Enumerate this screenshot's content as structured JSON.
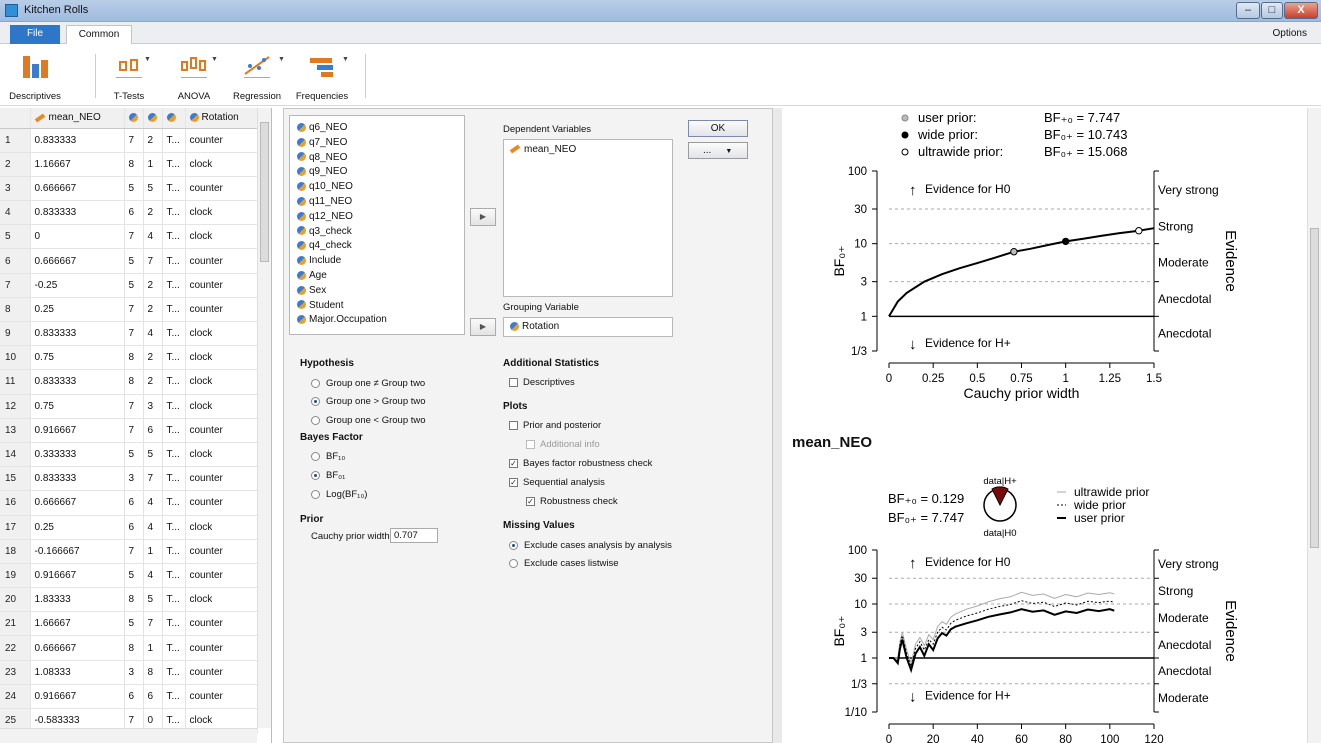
{
  "window": {
    "title": "Kitchen Rolls",
    "minimize": "–",
    "maximize": "□",
    "close": "X"
  },
  "tabs": {
    "file": "File",
    "common": "Common",
    "options": "Options"
  },
  "ribbon": [
    {
      "label": "Descriptives",
      "icon": "descriptives-icon"
    },
    {
      "label": "T-Tests",
      "icon": "ttests-icon"
    },
    {
      "label": "ANOVA",
      "icon": "anova-icon"
    },
    {
      "label": "Regression",
      "icon": "regression-icon"
    },
    {
      "label": "Frequencies",
      "icon": "frequencies-icon"
    }
  ],
  "grid": {
    "columns": [
      "mean_NEO",
      "",
      "",
      "",
      "Rotation"
    ],
    "rows": [
      [
        "1",
        "0.833333",
        "7",
        "2",
        "T...",
        "counter"
      ],
      [
        "2",
        "1.16667",
        "8",
        "1",
        "T...",
        "clock"
      ],
      [
        "3",
        "0.666667",
        "5",
        "5",
        "T...",
        "counter"
      ],
      [
        "4",
        "0.833333",
        "6",
        "2",
        "T...",
        "clock"
      ],
      [
        "5",
        "0",
        "7",
        "4",
        "T...",
        "clock"
      ],
      [
        "6",
        "0.666667",
        "5",
        "7",
        "T...",
        "counter"
      ],
      [
        "7",
        "-0.25",
        "5",
        "2",
        "T...",
        "counter"
      ],
      [
        "8",
        "0.25",
        "7",
        "2",
        "T...",
        "counter"
      ],
      [
        "9",
        "0.833333",
        "7",
        "4",
        "T...",
        "clock"
      ],
      [
        "10",
        "0.75",
        "8",
        "2",
        "T...",
        "clock"
      ],
      [
        "11",
        "0.833333",
        "8",
        "2",
        "T...",
        "clock"
      ],
      [
        "12",
        "0.75",
        "7",
        "3",
        "T...",
        "clock"
      ],
      [
        "13",
        "0.916667",
        "7",
        "6",
        "T...",
        "counter"
      ],
      [
        "14",
        "0.333333",
        "5",
        "5",
        "T...",
        "clock"
      ],
      [
        "15",
        "0.833333",
        "3",
        "7",
        "T...",
        "counter"
      ],
      [
        "16",
        "0.666667",
        "6",
        "4",
        "T...",
        "counter"
      ],
      [
        "17",
        "0.25",
        "6",
        "4",
        "T...",
        "clock"
      ],
      [
        "18",
        "-0.166667",
        "7",
        "1",
        "T...",
        "counter"
      ],
      [
        "19",
        "0.916667",
        "5",
        "4",
        "T...",
        "counter"
      ],
      [
        "20",
        "1.83333",
        "8",
        "5",
        "T...",
        "clock"
      ],
      [
        "21",
        "1.66667",
        "5",
        "7",
        "T...",
        "counter"
      ],
      [
        "22",
        "0.666667",
        "8",
        "1",
        "T...",
        "counter"
      ],
      [
        "23",
        "1.08333",
        "3",
        "8",
        "T...",
        "counter"
      ],
      [
        "24",
        "0.916667",
        "6",
        "6",
        "T...",
        "counter"
      ],
      [
        "25",
        "-0.583333",
        "7",
        "0",
        "T...",
        "clock"
      ]
    ]
  },
  "analysis": {
    "variables": [
      "q6_NEO",
      "q7_NEO",
      "q8_NEO",
      "q9_NEO",
      "q10_NEO",
      "q11_NEO",
      "q12_NEO",
      "q3_check",
      "q4_check",
      "Include",
      "Age",
      "Sex",
      "Student",
      "Major.Occupation"
    ],
    "dependent_label": "Dependent Variables",
    "dependent": "mean_NEO",
    "grouping_label": "Grouping Variable",
    "grouping": "Rotation",
    "ok": "OK",
    "more": "...",
    "hypothesis_title": "Hypothesis",
    "hypotheses": [
      "Group one ≠ Group two",
      "Group one > Group two",
      "Group one < Group two"
    ],
    "bf_title": "Bayes Factor",
    "bf_options": [
      "BF₁₀",
      "BF₀₁",
      "Log(BF₁₀)"
    ],
    "prior_title": "Prior",
    "cauchy_label": "Cauchy prior width",
    "cauchy_value": "0.707",
    "additional_title": "Additional Statistics",
    "descriptives": "Descriptives",
    "plots_title": "Plots",
    "prior_posterior": "Prior and posterior",
    "additional_info": "Additional info",
    "robustness": "Bayes factor robustness check",
    "sequential": "Sequential analysis",
    "robustness_check": "Robustness check",
    "missing_title": "Missing Values",
    "missing_options": [
      "Exclude cases analysis by analysis",
      "Exclude cases listwise"
    ]
  },
  "results": {
    "title": "mean_NEO",
    "chart_data": [
      {
        "type": "line",
        "xlabel": "Cauchy prior width",
        "ylabel": "BF₀₊",
        "right_label": "Evidence",
        "x_ticks": [
          "0",
          "0.25",
          "0.5",
          "0.75",
          "1",
          "1.25",
          "1.5"
        ],
        "y_ticks": [
          "100",
          "30",
          "10",
          "3",
          "1",
          "1/3"
        ],
        "evidence_labels": [
          "Very strong",
          "Strong",
          "Moderate",
          "Anecdotal",
          "Anecdotal"
        ],
        "top_note": "Evidence for H0",
        "bottom_note": "Evidence for H+",
        "legend": [
          {
            "name": "user prior:",
            "bf": "BF₊₀ = 7.747"
          },
          {
            "name": "wide prior:",
            "bf": "BF₀₊ = 10.743"
          },
          {
            "name": "ultrawide prior:",
            "bf": "BF₀₊ = 15.068"
          }
        ],
        "x": [
          0,
          0.05,
          0.1,
          0.2,
          0.3,
          0.4,
          0.5,
          0.6,
          0.707,
          0.8,
          0.9,
          1.0,
          1.1,
          1.2,
          1.3,
          1.414,
          1.5
        ],
        "y": [
          1,
          1.6,
          2.1,
          3.0,
          3.8,
          4.6,
          5.4,
          6.4,
          7.747,
          8.5,
          9.6,
          10.743,
          11.7,
          12.8,
          13.9,
          15.068,
          16.3
        ],
        "points": [
          {
            "x": 0.707,
            "y": 7.747
          },
          {
            "x": 1.0,
            "y": 10.743
          },
          {
            "x": 1.414,
            "y": 15.068
          }
        ]
      },
      {
        "type": "line",
        "xlabel": "",
        "ylabel": "BF₀₊",
        "right_label": "Evidence",
        "x_ticks": [
          "0",
          "20",
          "40",
          "60",
          "80",
          "100",
          "120"
        ],
        "y_ticks": [
          "100",
          "30",
          "10",
          "3",
          "1",
          "1/3",
          "1/10"
        ],
        "evidence_labels": [
          "Very strong",
          "Strong",
          "Moderate",
          "Anecdotal",
          "Anecdotal",
          "Moderate"
        ],
        "top_note": "Evidence for H0",
        "bottom_note": "Evidence for H+",
        "bf_text": [
          "BF₊₀ = 0.129",
          "BF₀₊ = 7.747"
        ],
        "pie_labels": [
          "data|H+",
          "data|H0"
        ],
        "legend": [
          "ultrawide prior",
          "wide prior",
          "user prior"
        ],
        "series": [
          {
            "name": "user prior",
            "x": [
              2,
              4,
              5,
              6,
              8,
              10,
              12,
              14,
              16,
              18,
              20,
              22,
              24,
              26,
              28,
              30,
              35,
              40,
              45,
              50,
              55,
              60,
              65,
              70,
              75,
              80,
              85,
              90,
              95,
              100,
              102
            ],
            "y": [
              1,
              0.8,
              1.5,
              2.2,
              1.0,
              0.6,
              1.2,
              1.6,
              1.1,
              1.8,
              1.4,
              2.3,
              2.9,
              2.6,
              3.4,
              3.8,
              4.4,
              5.0,
              5.8,
              6.4,
              7.0,
              8.0,
              7.2,
              7.6,
              6.3,
              7.3,
              6.8,
              7.9,
              7.4,
              8.0,
              7.5
            ]
          },
          {
            "name": "wide prior",
            "x": [
              2,
              4,
              5,
              6,
              8,
              10,
              12,
              14,
              16,
              18,
              20,
              22,
              24,
              26,
              28,
              30,
              35,
              40,
              45,
              50,
              55,
              60,
              65,
              70,
              75,
              80,
              85,
              90,
              95,
              100,
              102
            ],
            "y": [
              1,
              0.9,
              1.8,
              2.6,
              1.2,
              0.7,
              1.5,
              2.0,
              1.4,
              2.2,
              1.8,
              3.0,
              3.7,
              3.3,
              4.4,
              5.0,
              6.0,
              6.8,
              8.0,
              9.0,
              9.8,
              11.5,
              10.2,
              10.8,
              9.0,
              10.5,
              9.6,
              11.2,
              10.6,
              11.3,
              10.7
            ]
          },
          {
            "name": "ultrawide prior",
            "x": [
              2,
              4,
              5,
              6,
              8,
              10,
              12,
              14,
              16,
              18,
              20,
              22,
              24,
              26,
              28,
              30,
              35,
              40,
              45,
              50,
              55,
              60,
              65,
              70,
              75,
              80,
              85,
              90,
              95,
              100,
              102
            ],
            "y": [
              1,
              1.0,
              2.0,
              3.0,
              1.4,
              0.8,
              1.8,
              2.4,
              1.7,
              2.7,
              2.2,
              3.8,
              4.7,
              4.2,
              5.7,
              6.5,
              8.0,
              9.2,
              11.0,
              12.5,
              13.6,
              16.5,
              14.4,
              15.3,
              12.7,
              15.0,
              13.6,
              16.0,
              15.0,
              16.2,
              15.3
            ]
          }
        ]
      }
    ]
  }
}
